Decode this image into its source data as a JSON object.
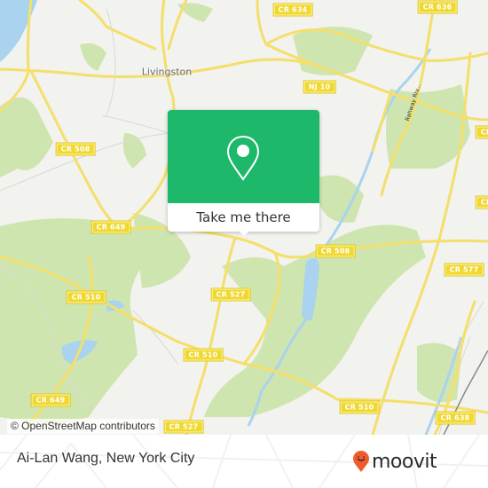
{
  "map": {
    "place_labels": [
      {
        "name": "livingston",
        "text": "Livingston"
      }
    ],
    "river_labels": [
      {
        "name": "rahway-river",
        "text": "Rahway Riv..."
      }
    ],
    "road_shields": [
      {
        "id": "cr634",
        "text": "CR 634"
      },
      {
        "id": "cr636",
        "text": "CR 636"
      },
      {
        "id": "nj10",
        "text": "NJ 10"
      },
      {
        "id": "cr508-west",
        "text": "CR 508"
      },
      {
        "id": "cr508-east",
        "text": "CR 508"
      },
      {
        "id": "cr649-north",
        "text": "CR 649"
      },
      {
        "id": "cr649-south",
        "text": "CR 649"
      },
      {
        "id": "cr510-west",
        "text": "CR 510"
      },
      {
        "id": "cr510-mid",
        "text": "CR 510"
      },
      {
        "id": "cr510-east",
        "text": "CR 510"
      },
      {
        "id": "cr527",
        "text": "CR 527"
      },
      {
        "id": "cr527-south",
        "text": "CR 527"
      },
      {
        "id": "cr577",
        "text": "CR 577"
      },
      {
        "id": "cr638",
        "text": "CR 638"
      },
      {
        "id": "cr-edge-1",
        "text": "CR"
      },
      {
        "id": "cr-edge-2",
        "text": "CR"
      }
    ],
    "attribution": "© OpenStreetMap contributors"
  },
  "popup": {
    "icon": "location-pin-icon",
    "button_label": "Take me there",
    "color": "#1eb86a"
  },
  "footer": {
    "title": "Ai-Lan Wang, New York City",
    "logo_text": "moovit",
    "logo_color": "#f15a2b"
  }
}
